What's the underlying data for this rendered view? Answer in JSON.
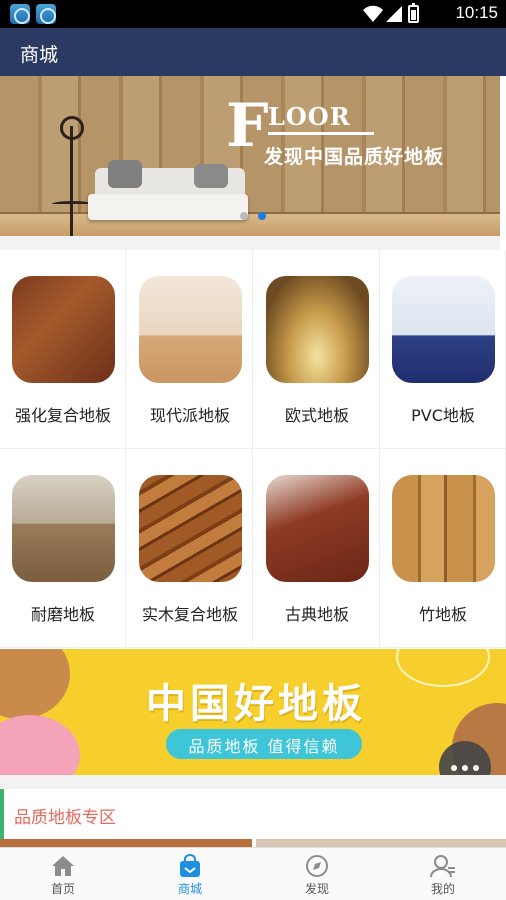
{
  "status_bar": {
    "time": "10:15",
    "app_icons": [
      "notification-app-icon",
      "notification-app-icon"
    ],
    "icons": [
      "wifi-icon",
      "cell-signal-icon",
      "battery-icon"
    ]
  },
  "app_bar": {
    "title": "商城"
  },
  "banner": {
    "brand_initial": "F",
    "brand_rest": "LOOR",
    "subtitle": "发现中国品质好地板",
    "slide_count": 2,
    "active_slide": 2
  },
  "categories": [
    {
      "label": "强化复合地板",
      "image": "laminate-floor-photo"
    },
    {
      "label": "现代派地板",
      "image": "modern-room-photo"
    },
    {
      "label": "欧式地板",
      "image": "european-hall-photo"
    },
    {
      "label": "PVC地板",
      "image": "pvc-corridor-photo"
    },
    {
      "label": "耐磨地板",
      "image": "living-room-photo"
    },
    {
      "label": "实木复合地板",
      "image": "wood-planks-photo"
    },
    {
      "label": "古典地板",
      "image": "classic-floor-photo"
    },
    {
      "label": "竹地板",
      "image": "bamboo-floor-photo"
    }
  ],
  "promo": {
    "title": "中国好地板",
    "subtitle": "品质地板 值得信赖"
  },
  "fab": {
    "icon": "more-dots-icon"
  },
  "section": {
    "title": "品质地板专区"
  },
  "bottom_nav": {
    "items": [
      {
        "label": "首页",
        "icon": "home-icon",
        "active": false
      },
      {
        "label": "商城",
        "icon": "shop-bag-icon",
        "active": true
      },
      {
        "label": "发现",
        "icon": "compass-icon",
        "active": false
      },
      {
        "label": "我的",
        "icon": "user-icon",
        "active": false
      }
    ]
  },
  "colors": {
    "app_bar": "#2b3a63",
    "nav_active": "#1e8fe1",
    "section_accent": "#3cb371",
    "section_title": "#e36a5c",
    "promo_bg": "#f7cf2c",
    "banner_dot_active": "#1e7be0"
  }
}
